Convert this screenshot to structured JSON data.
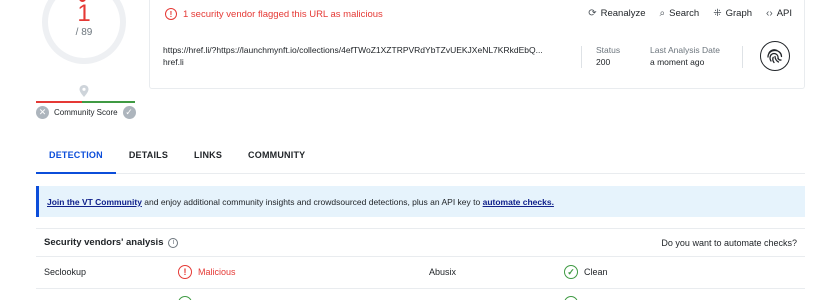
{
  "score": {
    "detections": "1",
    "total": "/ 89",
    "community_label": "Community Score"
  },
  "alert": {
    "text": "1 security vendor flagged this URL as malicious"
  },
  "actions": [
    {
      "label": "Reanalyze",
      "glyph": "⟳"
    },
    {
      "label": "Search",
      "glyph": "⌕"
    },
    {
      "label": "Graph",
      "glyph": "⁜"
    },
    {
      "label": "API",
      "glyph": "‹›"
    }
  ],
  "url": {
    "full": "https://href.li/?https://launchmynft.io/collections/4efTWoZ1XZTRPVRdYbTZvUEKJXeNL7KRkdEbQ...",
    "domain": "href.li"
  },
  "meta": {
    "status_label": "Status",
    "status_value": "200",
    "last_label": "Last Analysis Date",
    "last_value": "a moment ago"
  },
  "tabs": [
    "DETECTION",
    "DETAILS",
    "LINKS",
    "COMMUNITY"
  ],
  "banner": {
    "link1": "Join the VT Community",
    "text": " and enjoy additional community insights and crowdsourced detections, plus an API key to ",
    "link2": "automate checks."
  },
  "vendors": {
    "title": "Security vendors' analysis",
    "right": "Do you want to automate checks?",
    "rows": [
      {
        "v1": "Seclookup",
        "r1": "Malicious",
        "v2": "Abusix",
        "r2": "Clean"
      }
    ]
  },
  "colors": {
    "malicious": "#e53935",
    "clean": "#3f9a43",
    "accent": "#0b4dda"
  },
  "icons": [
    "alert-circle-icon",
    "refresh-icon",
    "search-icon",
    "graph-icon",
    "api-icon",
    "location-pin-icon",
    "thumbs-down-icon",
    "thumbs-up-icon",
    "info-icon",
    "check-circle-icon",
    "fingerprint-icon"
  ]
}
